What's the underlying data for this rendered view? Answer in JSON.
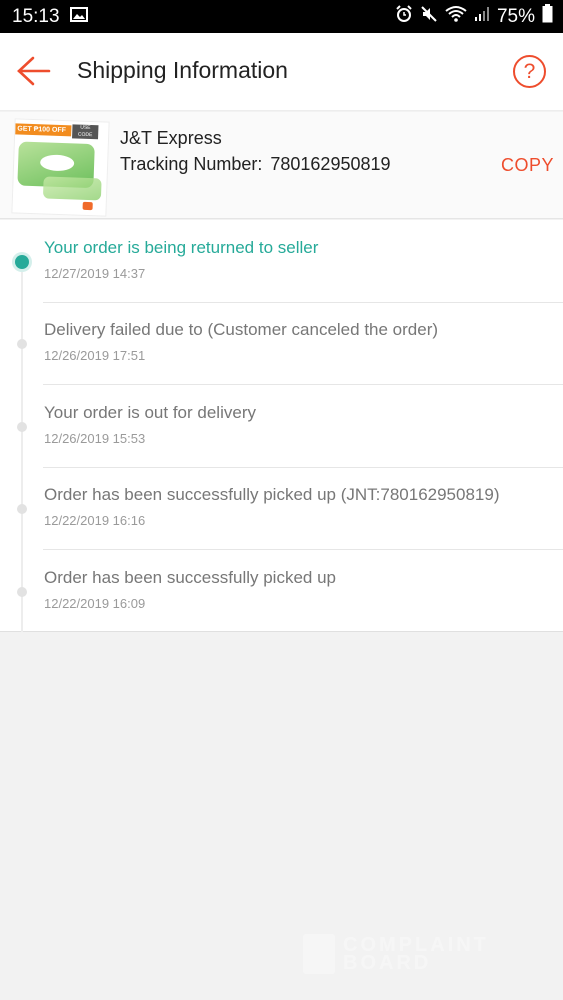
{
  "status_bar": {
    "time": "15:13",
    "battery": "75%",
    "icons": [
      "gallery-icon",
      "alarm-icon",
      "mute-icon",
      "wifi-icon",
      "signal-icon",
      "battery-icon"
    ]
  },
  "header": {
    "title": "Shipping Information",
    "help_label": "?"
  },
  "carrier": {
    "name": "J&T Express",
    "tracking_label": "Tracking Number:",
    "tracking_number": "780162950819",
    "copy_label": "COPY",
    "thumbnail": {
      "promo_text": "GET ₱100 OFF",
      "code_text": "USE CODE SS25197"
    }
  },
  "events": [
    {
      "text": "Your order is being returned to seller",
      "time": "12/27/2019 14:37",
      "active": true
    },
    {
      "text": "Delivery failed due to (Customer canceled the order)",
      "time": "12/26/2019 17:51",
      "active": false
    },
    {
      "text": "Your order is out for delivery",
      "time": "12/26/2019 15:53",
      "active": false
    },
    {
      "text": "Order has been successfully picked up (JNT:780162950819)",
      "time": "12/22/2019 16:16",
      "active": false
    },
    {
      "text": "Order has been successfully picked up",
      "time": "12/22/2019 16:09",
      "active": false
    }
  ],
  "watermark": {
    "line1": "COMPLAINT",
    "line2": "BOARD"
  },
  "colors": {
    "accent": "#ee4d2d",
    "active_status": "#26aa99"
  }
}
